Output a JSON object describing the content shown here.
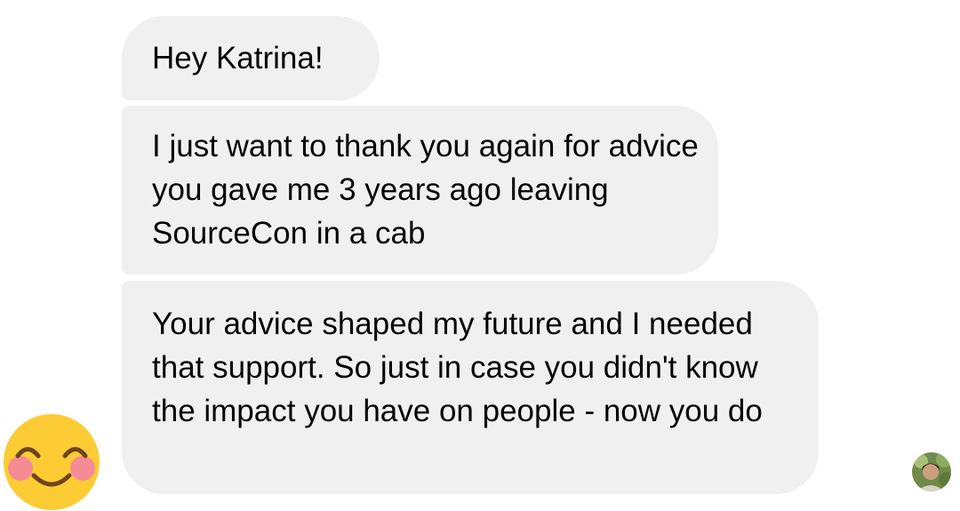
{
  "messages": [
    {
      "text": "Hey Katrina!"
    },
    {
      "text": "I just want to thank you again for advice you gave me 3 years ago leaving SourceCon in a cab"
    },
    {
      "text": "Your advice shaped my future and I needed that support. So just in case you didn't know the impact you have on people - now you do"
    }
  ],
  "reaction_emoji": "smiling-face-with-smiling-eyes",
  "bubble_color": "#f0f0f0",
  "text_color": "#050505"
}
